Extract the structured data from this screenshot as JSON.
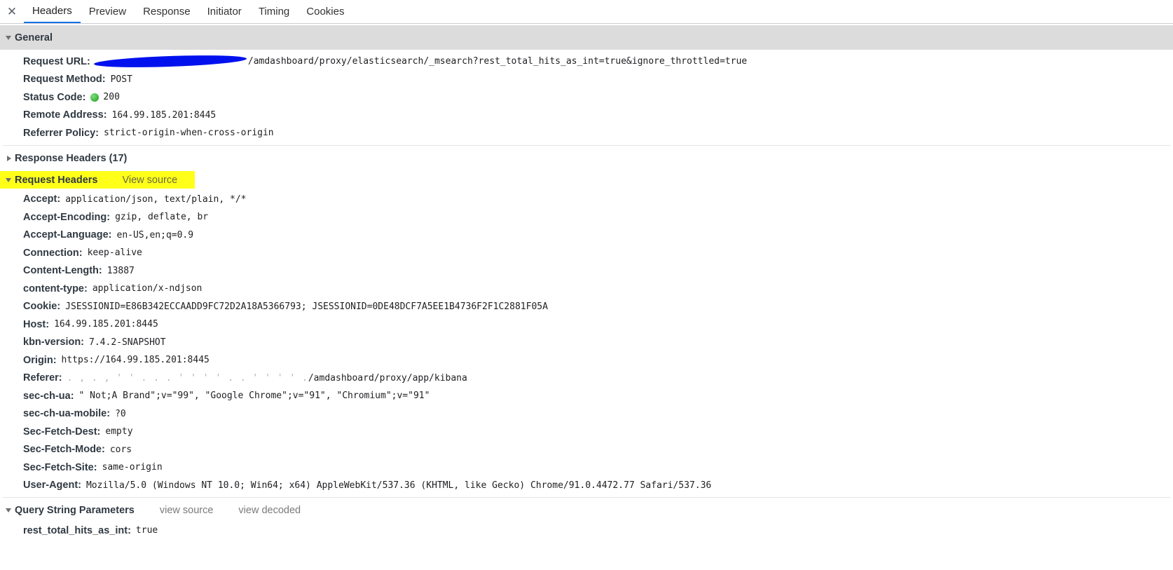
{
  "tabs": {
    "close_symbol": "✕",
    "items": [
      {
        "label": "Headers"
      },
      {
        "label": "Preview"
      },
      {
        "label": "Response"
      },
      {
        "label": "Initiator"
      },
      {
        "label": "Timing"
      },
      {
        "label": "Cookies"
      }
    ],
    "active": "Headers"
  },
  "general": {
    "title": "General",
    "request_url_key": "Request URL:",
    "request_url_value": "/amdashboard/proxy/elasticsearch/_msearch?rest_total_hits_as_int=true&ignore_throttled=true",
    "request_method_key": "Request Method:",
    "request_method_value": "POST",
    "status_code_key": "Status Code:",
    "status_code_value": "200",
    "status_color": "#1a9b1a",
    "remote_address_key": "Remote Address:",
    "remote_address_value": "164.99.185.201:8445",
    "referrer_policy_key": "Referrer Policy:",
    "referrer_policy_value": "strict-origin-when-cross-origin"
  },
  "response_headers": {
    "title": "Response Headers (17)"
  },
  "request_headers": {
    "title": "Request Headers",
    "link": "View source",
    "highlight_color": "#ffff1a",
    "rows": [
      {
        "key": "Accept:",
        "value": "application/json, text/plain, */*"
      },
      {
        "key": "Accept-Encoding:",
        "value": "gzip, deflate, br"
      },
      {
        "key": "Accept-Language:",
        "value": "en-US,en;q=0.9"
      },
      {
        "key": "Connection:",
        "value": "keep-alive"
      },
      {
        "key": "Content-Length:",
        "value": "13887"
      },
      {
        "key": "content-type:",
        "value": "application/x-ndjson"
      },
      {
        "key": "Cookie:",
        "value": "JSESSIONID=E86B342ECCAADD9FC72D2A18A5366793; JSESSIONID=0DE48DCF7A5EE1B4736F2F1C2881F05A"
      },
      {
        "key": "Host:",
        "value": "164.99.185.201:8445"
      },
      {
        "key": "kbn-version:",
        "value": "7.4.2-SNAPSHOT"
      },
      {
        "key": "Origin:",
        "value": "https://164.99.185.201:8445"
      }
    ],
    "referer_key": "Referer:",
    "referer_value": "/amdashboard/proxy/app/kibana",
    "rows2": [
      {
        "key": "sec-ch-ua:",
        "value": "\" Not;A Brand\";v=\"99\", \"Google Chrome\";v=\"91\", \"Chromium\";v=\"91\""
      },
      {
        "key": "sec-ch-ua-mobile:",
        "value": "?0"
      },
      {
        "key": "Sec-Fetch-Dest:",
        "value": "empty"
      },
      {
        "key": "Sec-Fetch-Mode:",
        "value": "cors"
      },
      {
        "key": "Sec-Fetch-Site:",
        "value": "same-origin"
      },
      {
        "key": "User-Agent:",
        "value": "Mozilla/5.0 (Windows NT 10.0; Win64; x64) AppleWebKit/537.36 (KHTML, like Gecko) Chrome/91.0.4472.77 Safari/537.36"
      }
    ]
  },
  "query_string": {
    "title": "Query String Parameters",
    "link_source": "view source",
    "link_decoded": "view decoded",
    "rows": [
      {
        "key": "rest_total_hits_as_int:",
        "value": "true"
      }
    ]
  }
}
